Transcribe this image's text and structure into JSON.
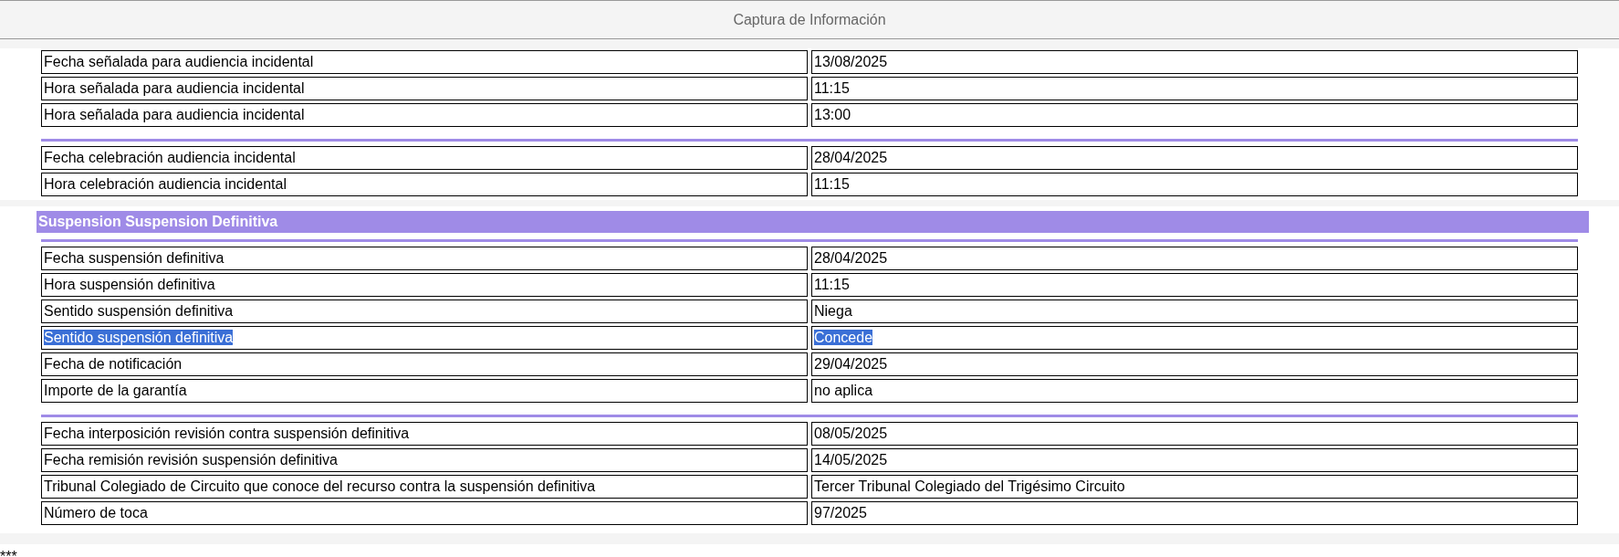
{
  "title": "Captura de Información",
  "panels": [
    {
      "groups": [
        {
          "rows": [
            {
              "label": "Fecha señalada para audiencia incidental",
              "value": "13/08/2025",
              "selected": false
            },
            {
              "label": "Hora señalada para audiencia incidental",
              "value": "11:15",
              "selected": false
            },
            {
              "label": "Hora señalada para audiencia incidental",
              "value": "13:00",
              "selected": false
            }
          ]
        },
        {
          "rows": [
            {
              "label": "Fecha celebración audiencia incidental",
              "value": "28/04/2025",
              "selected": false
            },
            {
              "label": "Hora celebración audiencia incidental",
              "value": "11:15",
              "selected": false
            }
          ]
        }
      ]
    },
    {
      "heading": "Suspension Suspension Definitiva",
      "groups": [
        {
          "rows": [
            {
              "label": "Fecha suspensión definitiva",
              "value": "28/04/2025",
              "selected": false
            },
            {
              "label": "Hora suspensión definitiva",
              "value": "11:15",
              "selected": false
            },
            {
              "label": "Sentido suspensión definitiva",
              "value": "Niega",
              "selected": false
            },
            {
              "label": "Sentido suspensión definitiva ",
              "value": "Concede",
              "selected": true
            },
            {
              "label": "Fecha de notificación",
              "value": "29/04/2025",
              "selected": false
            },
            {
              "label": "Importe de la garantía",
              "value": "no aplica",
              "selected": false
            }
          ]
        },
        {
          "rows": [
            {
              "label": "Fecha interposición revisión contra suspensión definitiva",
              "value": "08/05/2025",
              "selected": false
            },
            {
              "label": "Fecha remisión revisión suspensión definitiva",
              "value": "14/05/2025",
              "selected": false
            },
            {
              "label": "Tribunal Colegiado de Circuito que conoce del recurso contra la suspensión definitiva",
              "value": "Tercer Tribunal Colegiado del Trigésimo Circuito",
              "selected": false
            },
            {
              "label": "Número de toca",
              "value": "97/2025",
              "selected": false
            }
          ]
        }
      ]
    }
  ],
  "footer_text": "***"
}
